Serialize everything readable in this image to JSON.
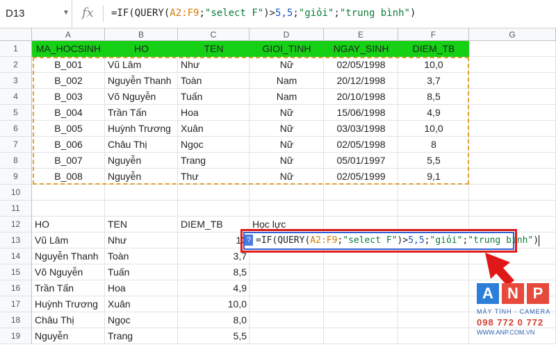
{
  "formula_bar": {
    "cell_ref": "D13",
    "fx_label": "fx",
    "formula_parts": [
      {
        "t": "=IF(QUERY(",
        "c": ""
      },
      {
        "t": "A2:F9",
        "c": "rng"
      },
      {
        "t": ";",
        "c": ""
      },
      {
        "t": "\"select F\"",
        "c": "str"
      },
      {
        "t": ")>",
        "c": ""
      },
      {
        "t": "5,5",
        "c": "num"
      },
      {
        "t": ";",
        "c": ""
      },
      {
        "t": "\"giỏi\"",
        "c": "str"
      },
      {
        "t": ";",
        "c": ""
      },
      {
        "t": "\"trung bình\"",
        "c": "str"
      },
      {
        "t": ")",
        "c": ""
      }
    ]
  },
  "columns": [
    "A",
    "B",
    "C",
    "D",
    "E",
    "F",
    "G"
  ],
  "rows": [
    "1",
    "2",
    "3",
    "4",
    "5",
    "6",
    "7",
    "8",
    "9",
    "10",
    "11",
    "12",
    "13",
    "14",
    "15",
    "16",
    "17",
    "18",
    "19"
  ],
  "table1": {
    "headers": [
      "MA_HOCSINH",
      "HO",
      "TEN",
      "GIOI_TINH",
      "NGAY_SINH",
      "DIEM_TB"
    ],
    "rows": [
      [
        "B_001",
        "Vũ Lâm",
        "Như",
        "Nữ",
        "02/05/1998",
        "10,0"
      ],
      [
        "B_002",
        "Nguyễn Thanh",
        "Toàn",
        "Nam",
        "20/12/1998",
        "3,7"
      ],
      [
        "B_003",
        "Võ Nguyễn",
        "Tuấn",
        "Nam",
        "20/10/1998",
        "8,5"
      ],
      [
        "B_004",
        "Trần Tấn",
        "Hoa",
        "Nữ",
        "15/06/1998",
        "4,9"
      ],
      [
        "B_005",
        "Huỳnh Trương",
        "Xuân",
        "Nữ",
        "03/03/1998",
        "10,0"
      ],
      [
        "B_006",
        "Châu Thị",
        "Ngọc",
        "Nữ",
        "02/05/1998",
        "8"
      ],
      [
        "B_007",
        "Nguyễn",
        "Trang",
        "Nữ",
        "05/01/1997",
        "5,5"
      ],
      [
        "B_008",
        "Nguyễn",
        "Thư",
        "Nữ",
        "02/05/1999",
        "9,1"
      ]
    ]
  },
  "table2": {
    "headers": [
      "HO",
      "TEN",
      "DIEM_TB",
      "Học lực"
    ],
    "rows": [
      [
        "Vũ Lâm",
        "Như",
        "10"
      ],
      [
        "Nguyễn Thanh",
        "Toàn",
        "3,7"
      ],
      [
        "Võ Nguyễn",
        "Tuấn",
        "8,5"
      ],
      [
        "Trần Tấn",
        "Hoa",
        "4,9"
      ],
      [
        "Huỳnh Trương",
        "Xuân",
        "10,0"
      ],
      [
        "Châu Thị",
        "Ngọc",
        "8,0"
      ],
      [
        "Nguyễn",
        "Trang",
        "5,5"
      ]
    ]
  },
  "editor_badge": "?",
  "logo": {
    "letters": [
      "A",
      "N",
      "P"
    ],
    "line1": "MÁY TÍNH - CAMERA",
    "line2": "098 772 0 772",
    "line3": "WWW.ANP.COM.VN"
  },
  "colors": {
    "header_green": "#15d015",
    "selection_dash": "#e0a030",
    "editor_blue": "#2f63d6",
    "highlight_red": "#e01818"
  }
}
